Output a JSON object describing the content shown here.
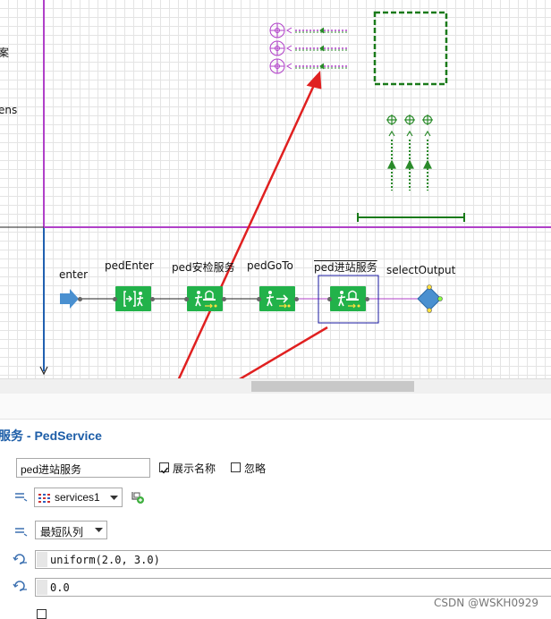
{
  "canvas": {
    "left_partial_label_1": "案",
    "left_partial_label_2": "ens",
    "blocks": [
      {
        "label": "enter"
      },
      {
        "label": "pedEnter"
      },
      {
        "label": "ped安检服务"
      },
      {
        "label": "pedGoTo"
      },
      {
        "label": "ped进站服务"
      },
      {
        "label": "selectOutput"
      }
    ]
  },
  "properties": {
    "title": "服务 - PedService",
    "name_value": "ped进站服务",
    "show_name_label": "展示名称",
    "show_name_checked": true,
    "ignore_label": "忽略",
    "ignore_checked": false,
    "services_value": "services1",
    "queue_value": "最短队列",
    "delay_value": "uniform(2.0, 3.0)",
    "zero_value": "0.0"
  },
  "watermark": "CSDN @WSKH0929",
  "colors": {
    "block_green": "#22b24a",
    "purple_line": "#b040c8",
    "blue_line": "#2060b0",
    "arrow_red": "#e02020",
    "title_blue": "#1e5ea8"
  }
}
